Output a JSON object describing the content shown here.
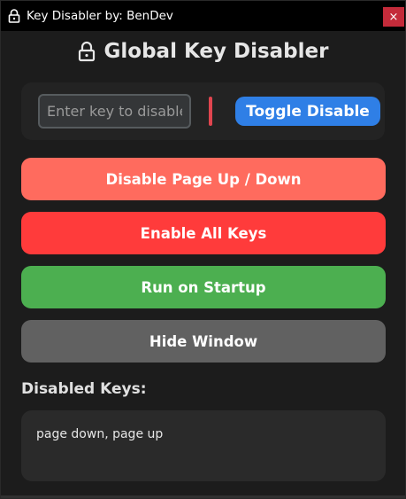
{
  "window": {
    "title": "Key Disabler by: BenDev",
    "close_label": "×"
  },
  "heading": {
    "text": "Global Key Disabler"
  },
  "input_panel": {
    "key_input": {
      "value": "",
      "placeholder": "Enter key to disable, e.g. 'a'"
    },
    "toggle_label": "Toggle Disable"
  },
  "buttons": {
    "page_updown": "Disable Page Up / Down",
    "enable_all": "Enable All Keys",
    "startup": "Run on Startup",
    "hide": "Hide Window"
  },
  "disabled_keys": {
    "label": "Disabled Keys:",
    "text": "page down, page up"
  },
  "colors": {
    "titlebar": "#000000",
    "close": "#c42b3a",
    "toggle": "#2f7fe6",
    "page_updown": "#ff6b5e",
    "enable_all": "#ff3b3b",
    "startup": "#4caf50",
    "hide": "#616161",
    "indicator": "#e0454f"
  }
}
